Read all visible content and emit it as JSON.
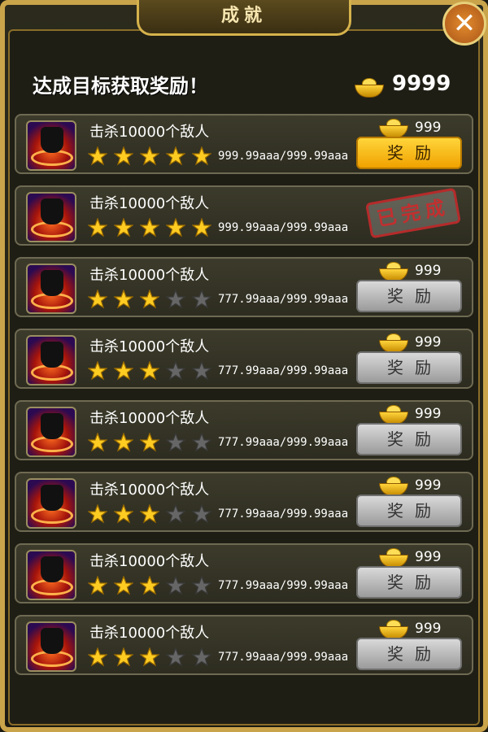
{
  "window": {
    "title": "成就"
  },
  "header": {
    "text": "达成目标获取奖励！",
    "gold_value": "9999"
  },
  "colors": {
    "accent_gold": "#ffd43b",
    "frame": "#caa44a",
    "star_filled": "#ffcc22",
    "star_empty": "#666666",
    "stamp_red": "#c22f2f"
  },
  "items": [
    {
      "name": "击杀10000个敌人",
      "stars_filled": 5,
      "stars_total": 5,
      "progress": "999.99aaa/999.99aaa",
      "reward_value": "999",
      "status": "claimable",
      "button_label": "奖励"
    },
    {
      "name": "击杀10000个敌人",
      "stars_filled": 5,
      "stars_total": 5,
      "progress": "999.99aaa/999.99aaa",
      "reward_value": "",
      "status": "completed",
      "stamp_label": "已完成"
    },
    {
      "name": "击杀10000个敌人",
      "stars_filled": 3,
      "stars_total": 5,
      "progress": "777.99aaa/999.99aaa",
      "reward_value": "999",
      "status": "locked",
      "button_label": "奖励"
    },
    {
      "name": "击杀10000个敌人",
      "stars_filled": 3,
      "stars_total": 5,
      "progress": "777.99aaa/999.99aaa",
      "reward_value": "999",
      "status": "locked",
      "button_label": "奖励"
    },
    {
      "name": "击杀10000个敌人",
      "stars_filled": 3,
      "stars_total": 5,
      "progress": "777.99aaa/999.99aaa",
      "reward_value": "999",
      "status": "locked",
      "button_label": "奖励"
    },
    {
      "name": "击杀10000个敌人",
      "stars_filled": 3,
      "stars_total": 5,
      "progress": "777.99aaa/999.99aaa",
      "reward_value": "999",
      "status": "locked",
      "button_label": "奖励"
    },
    {
      "name": "击杀10000个敌人",
      "stars_filled": 3,
      "stars_total": 5,
      "progress": "777.99aaa/999.99aaa",
      "reward_value": "999",
      "status": "locked",
      "button_label": "奖励"
    },
    {
      "name": "击杀10000个敌人",
      "stars_filled": 3,
      "stars_total": 5,
      "progress": "777.99aaa/999.99aaa",
      "reward_value": "999",
      "status": "locked",
      "button_label": "奖励"
    }
  ]
}
